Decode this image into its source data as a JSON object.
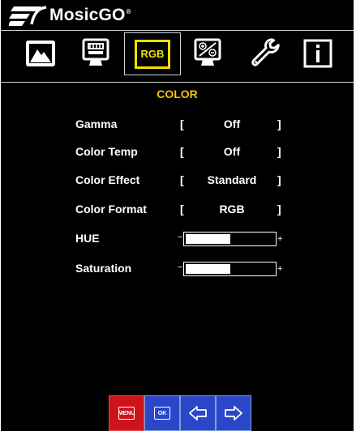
{
  "brand": {
    "name": "MosicGO",
    "reg_mark": "®"
  },
  "tabs": [
    {
      "icon": "picture-icon",
      "label": ""
    },
    {
      "icon": "display-icon",
      "label": ""
    },
    {
      "icon": "rgb-icon",
      "label": "RGB",
      "active": true
    },
    {
      "icon": "display-settings-icon",
      "label": ""
    },
    {
      "icon": "wrench-icon",
      "label": ""
    },
    {
      "icon": "info-icon",
      "label": ""
    }
  ],
  "section": {
    "title": "COLOR"
  },
  "options": [
    {
      "label": "Gamma",
      "open": "[",
      "value": "Off",
      "close": "]"
    },
    {
      "label": "Color Temp",
      "open": "[",
      "value": "Off",
      "close": "]"
    },
    {
      "label": "Color Effect",
      "open": "[",
      "value": "Standard",
      "close": "]"
    },
    {
      "label": "Color Format",
      "open": "[",
      "value": "RGB",
      "close": "]"
    }
  ],
  "sliders": [
    {
      "label": "HUE",
      "minus": "−",
      "plus": "+",
      "level": 0.52
    },
    {
      "label": "Saturation",
      "minus": "−",
      "plus": "+",
      "level": 0.52
    }
  ],
  "buttons": {
    "menu": "MENU",
    "ok": "OK",
    "left_icon": "arrow-left-icon",
    "right_icon": "arrow-right-icon"
  },
  "colors": {
    "background": "#000000",
    "accent": "#f5e000",
    "title": "#f5c400",
    "menu_button": "#d0121b",
    "nav_button": "#2b47c8"
  }
}
